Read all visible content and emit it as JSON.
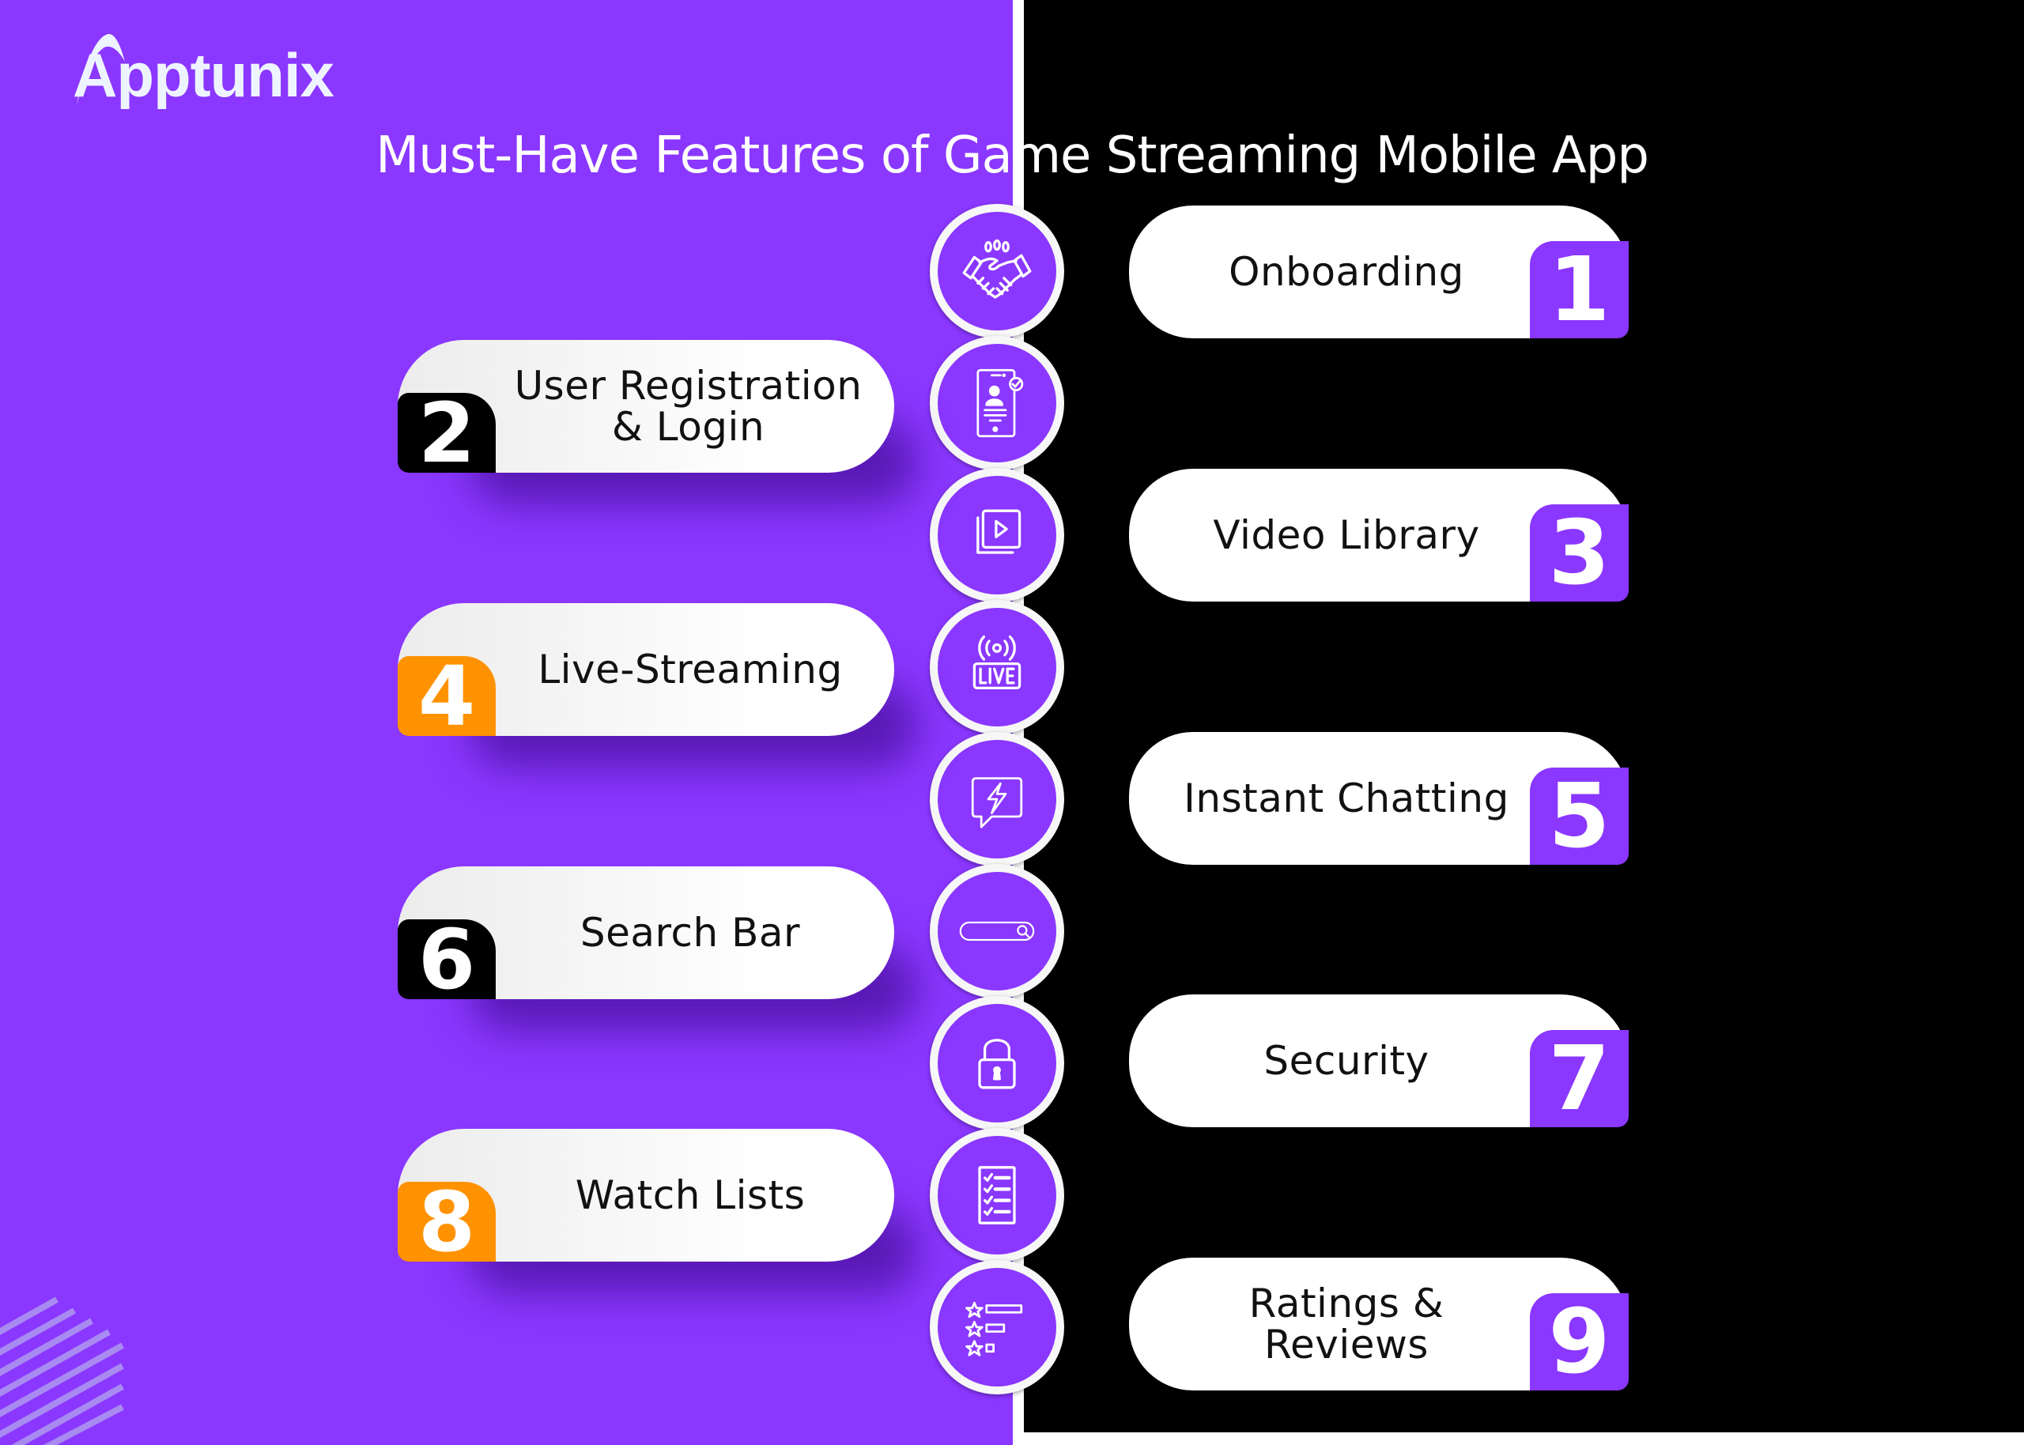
{
  "brand": {
    "logo_text": "Apptunix"
  },
  "title": "Must-Have Features of Game Streaming Mobile App",
  "colors": {
    "purple": "#8A37FF",
    "black": "#000000",
    "orange": "#FF9200",
    "white": "#FFFFFF"
  },
  "features": [
    {
      "number": "1",
      "label": "Onboarding",
      "side": "right",
      "badge_color": "#8A37FF",
      "icon": "handshake-icon"
    },
    {
      "number": "2",
      "label": "User Registration & Login",
      "side": "left",
      "badge_color": "#000000",
      "icon": "mobile-profile-check-icon"
    },
    {
      "number": "3",
      "label": "Video Library",
      "side": "right",
      "badge_color": "#8A37FF",
      "icon": "video-library-icon"
    },
    {
      "number": "4",
      "label": "Live-Streaming",
      "side": "left",
      "badge_color": "#FF9200",
      "icon": "live-broadcast-icon"
    },
    {
      "number": "5",
      "label": "Instant Chatting",
      "side": "right",
      "badge_color": "#8A37FF",
      "icon": "chat-lightning-icon"
    },
    {
      "number": "6",
      "label": "Search Bar",
      "side": "left",
      "badge_color": "#000000",
      "icon": "search-bar-icon"
    },
    {
      "number": "7",
      "label": "Security",
      "side": "right",
      "badge_color": "#8A37FF",
      "icon": "padlock-icon"
    },
    {
      "number": "8",
      "label": "Watch Lists",
      "side": "left",
      "badge_color": "#FF9200",
      "icon": "checklist-icon"
    },
    {
      "number": "9",
      "label": "Ratings & Reviews",
      "side": "right",
      "badge_color": "#8A37FF",
      "icon": "star-ratings-icon"
    }
  ]
}
